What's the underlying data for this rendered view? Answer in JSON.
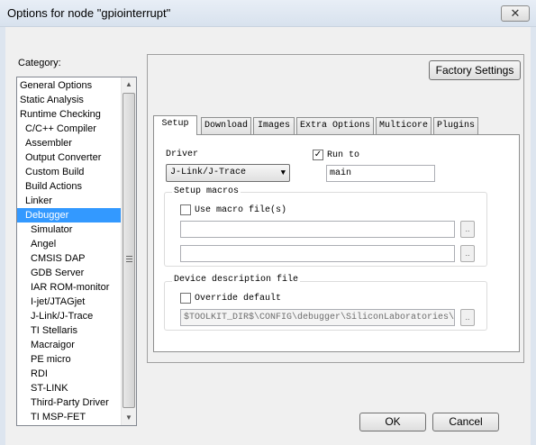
{
  "window": {
    "title": "Options for node \"gpiointerrupt\"",
    "close_glyph": "✕"
  },
  "category": {
    "label": "Category:",
    "items": [
      {
        "label": "General Options",
        "level": 0
      },
      {
        "label": "Static Analysis",
        "level": 0
      },
      {
        "label": "Runtime Checking",
        "level": 0
      },
      {
        "label": "C/C++ Compiler",
        "level": 1
      },
      {
        "label": "Assembler",
        "level": 1
      },
      {
        "label": "Output Converter",
        "level": 1
      },
      {
        "label": "Custom Build",
        "level": 1
      },
      {
        "label": "Build Actions",
        "level": 1
      },
      {
        "label": "Linker",
        "level": 1
      },
      {
        "label": "Debugger",
        "level": 1,
        "selected": true
      },
      {
        "label": "Simulator",
        "level": 2
      },
      {
        "label": "Angel",
        "level": 2
      },
      {
        "label": "CMSIS DAP",
        "level": 2
      },
      {
        "label": "GDB Server",
        "level": 2
      },
      {
        "label": "IAR ROM-monitor",
        "level": 2
      },
      {
        "label": "I-jet/JTAGjet",
        "level": 2
      },
      {
        "label": "J-Link/J-Trace",
        "level": 2
      },
      {
        "label": "TI Stellaris",
        "level": 2
      },
      {
        "label": "Macraigor",
        "level": 2
      },
      {
        "label": "PE micro",
        "level": 2
      },
      {
        "label": "RDI",
        "level": 2
      },
      {
        "label": "ST-LINK",
        "level": 2
      },
      {
        "label": "Third-Party Driver",
        "level": 2
      },
      {
        "label": "TI MSP-FET",
        "level": 2
      }
    ]
  },
  "factory_settings_label": "Factory Settings",
  "tabs": [
    {
      "label": "Setup",
      "active": true
    },
    {
      "label": "Download"
    },
    {
      "label": "Images"
    },
    {
      "label": "Extra Options"
    },
    {
      "label": "Multicore"
    },
    {
      "label": "Plugins"
    }
  ],
  "setup": {
    "driver_label": "Driver",
    "driver_value": "J-Link/J-Trace",
    "run_to_label": "Run to",
    "run_to_checked": true,
    "run_to_value": "main",
    "setup_macros": {
      "title": "Setup macros",
      "use_macro_label": "Use macro file(s)",
      "use_macro_checked": false,
      "macro_file_1": "",
      "macro_file_2": ""
    },
    "device_description": {
      "title": "Device description file",
      "override_label": "Override default",
      "override_checked": false,
      "path": "$TOOLKIT_DIR$\\CONFIG\\debugger\\SiliconLaboratories\\"
    },
    "browse_glyph": "..",
    "check_glyph": "✓"
  },
  "buttons": {
    "ok": "OK",
    "cancel": "Cancel"
  }
}
